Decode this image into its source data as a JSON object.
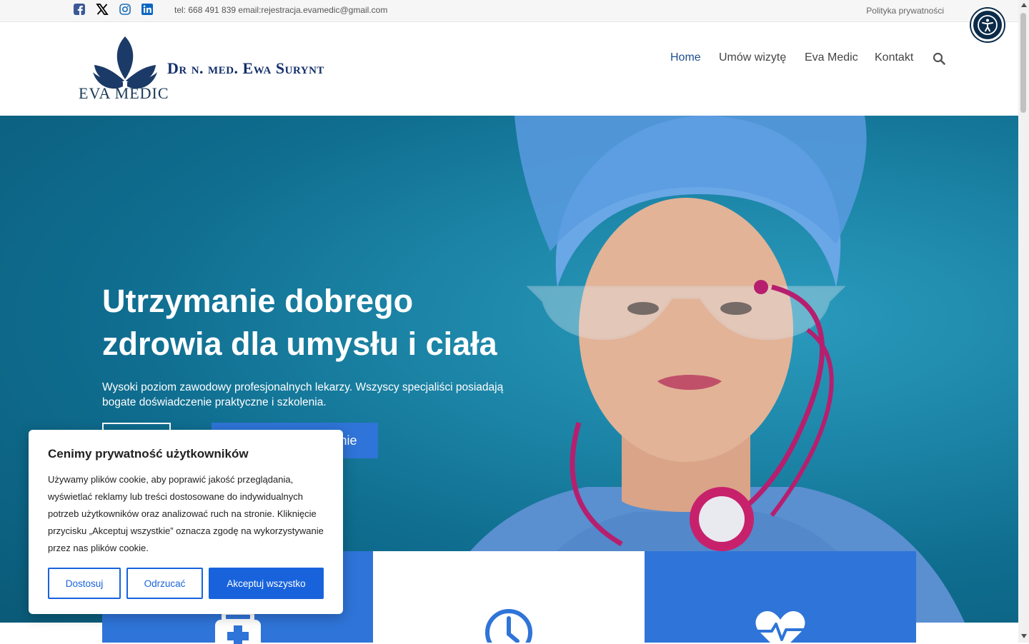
{
  "topbar": {
    "social": [
      {
        "icon": "facebook-square-icon",
        "color": "#3b5998"
      },
      {
        "icon": "x-twitter-icon",
        "color": "#000000"
      },
      {
        "icon": "instagram-icon",
        "color": "#1d6fb8"
      },
      {
        "icon": "linkedin-icon",
        "color": "#0a66c2"
      }
    ],
    "contact": "tel: 668 491 839 email:rejestracja.evamedic@gmail.com",
    "privacy_link": "Polityka prywatności"
  },
  "accessibility": {
    "icon": "accessibility-icon",
    "color": "#0b2b49"
  },
  "header": {
    "logo_text": "EVA MEDIC",
    "site_title": "Dr n. med. Ewa Surynt",
    "nav": [
      {
        "label": "Home",
        "active": true
      },
      {
        "label": "Umów wizytę",
        "active": false
      },
      {
        "label": "Eva Medic",
        "active": false
      },
      {
        "label": "Kontakt",
        "active": false
      }
    ],
    "search_icon": "search-icon"
  },
  "hero": {
    "title_line1": "Utrzymanie dobrego",
    "title_line2": "zdrowia dla umysłu i ciała",
    "subtitle": "Wysoki poziom zawodowy profesjonalnych lekarzy. Wszyscy specjaliści posiadają bogate doświadczenie praktyczne i szkolenia.",
    "primary_button_visible_fragment": "nie"
  },
  "cards": [
    {
      "icon": "medical-kit-icon",
      "color": "#2f74d8"
    },
    {
      "icon": "clock-icon",
      "color": "#ffffff"
    },
    {
      "icon": "heartbeat-icon",
      "color": "#2f74d8"
    }
  ],
  "cookie": {
    "title": "Cenimy prywatność użytkowników",
    "text": "Używamy plików cookie, aby poprawić jakość przeglądania, wyświetlać reklamy lub treści dostosowane do indywidualnych potrzeb użytkowników oraz analizować ruch na stronie. Kliknięcie przycisku „Akceptuj wszystkie” oznacza zgodę na wykorzystywanie przez nas plików cookie.",
    "customize_label": "Dostosuj",
    "reject_label": "Odrzucać",
    "accept_label": "Akceptuj wszystko",
    "accent_color": "#1863dc"
  }
}
